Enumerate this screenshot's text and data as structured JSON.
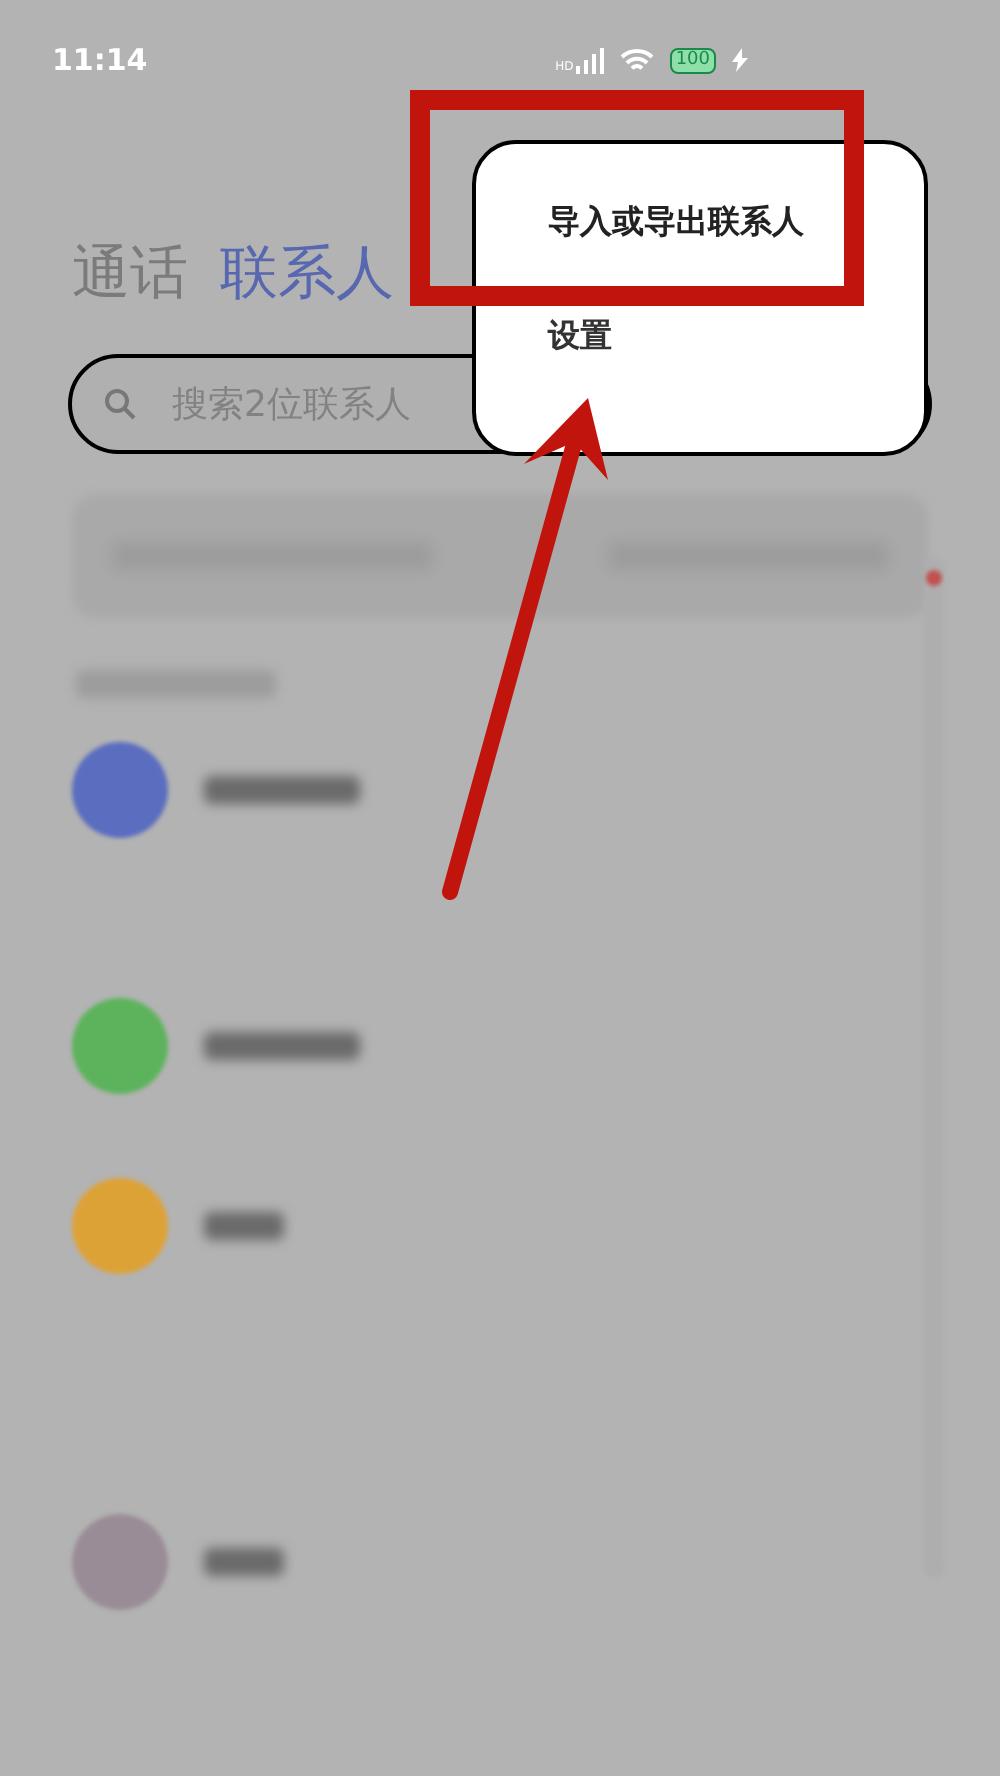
{
  "status_bar": {
    "time": "11:14",
    "network": "HD",
    "battery": "100"
  },
  "tabs": [
    {
      "label": "通话",
      "selected": false
    },
    {
      "label": "联系人",
      "selected": true
    }
  ],
  "search": {
    "placeholder": "搜索2位联系人"
  },
  "contacts": [
    {
      "kind": "card",
      "color": "#5a6dbf"
    },
    {
      "kind": "group",
      "color": "#5cb35c"
    },
    {
      "kind": "cloud",
      "color": "#dda236"
    },
    {
      "kind": "photo",
      "color": "#9a8c96"
    }
  ],
  "menu": {
    "items": [
      {
        "label": "导入或导出联系人",
        "highlighted": true
      },
      {
        "label": "设置",
        "highlighted": false
      }
    ]
  }
}
